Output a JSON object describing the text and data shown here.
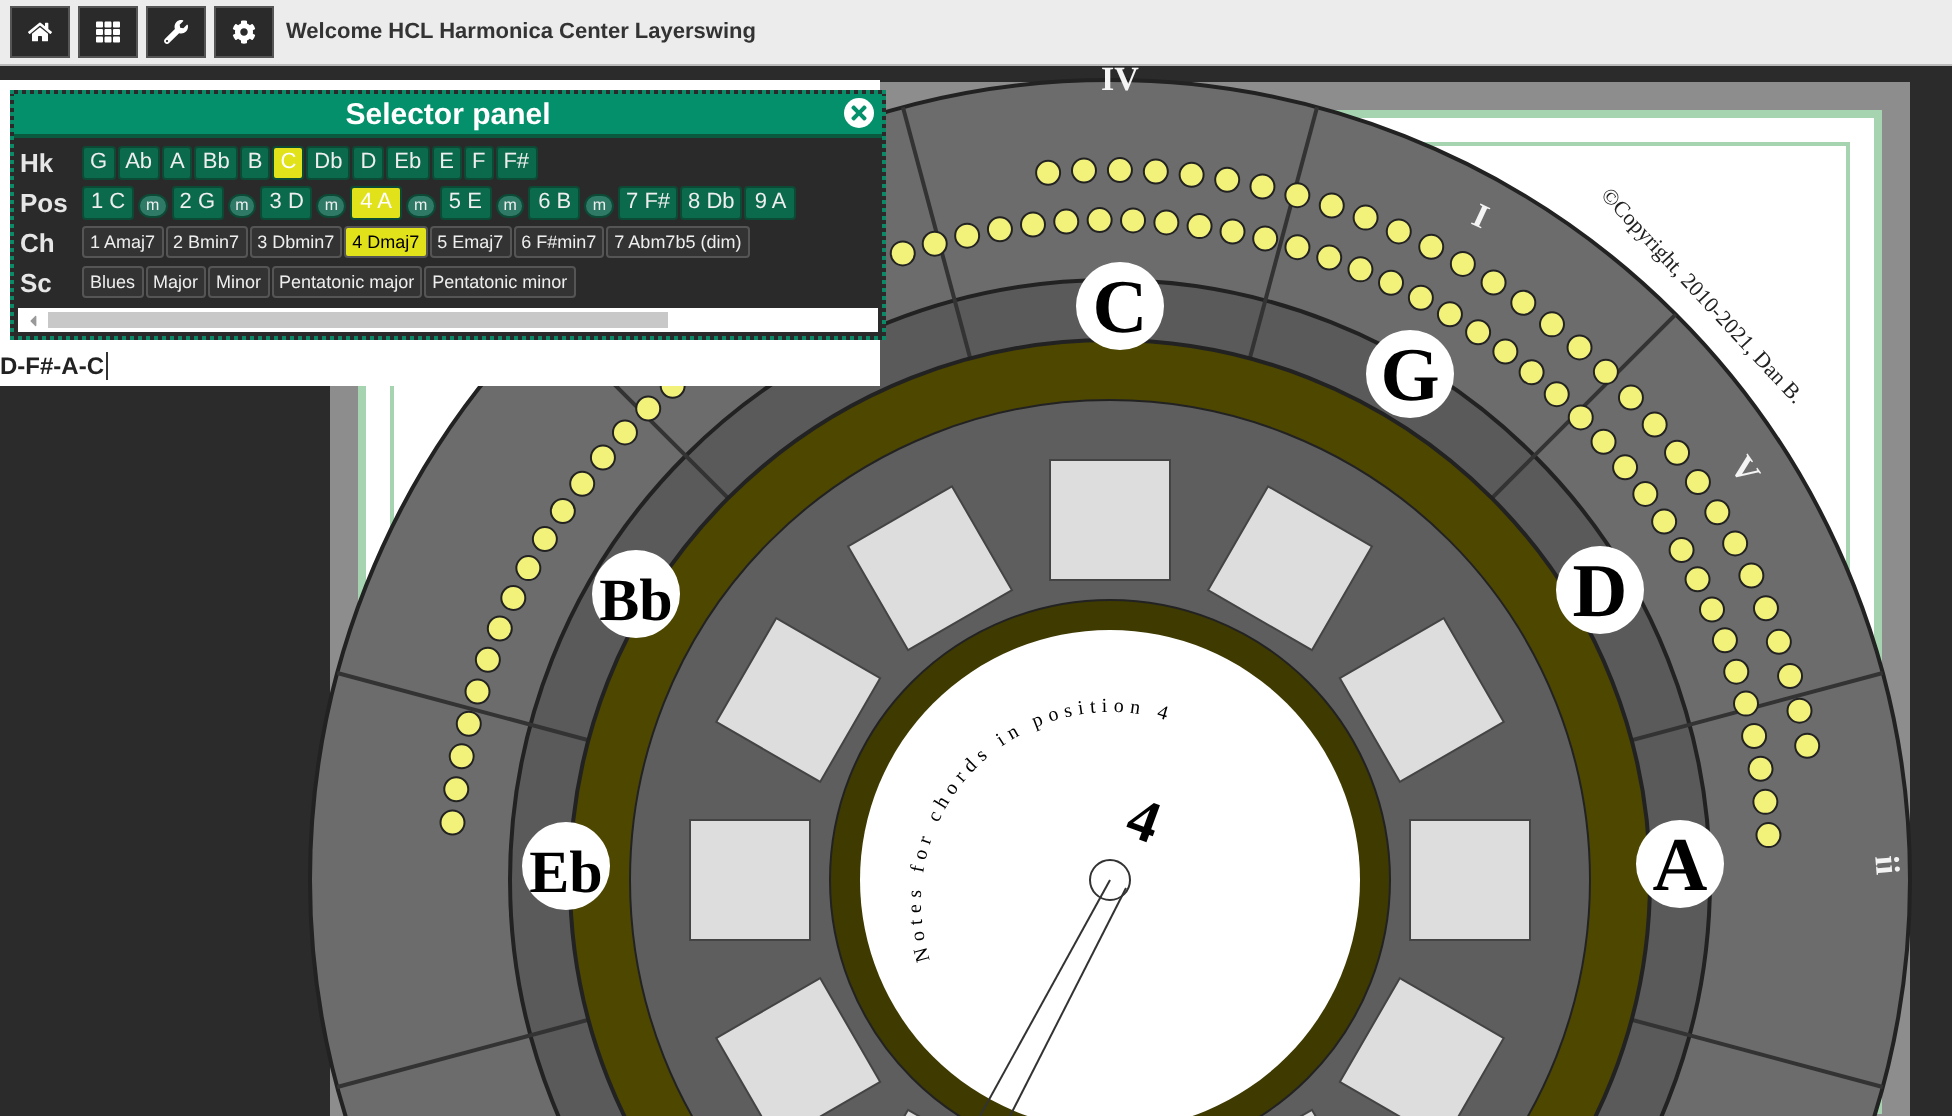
{
  "toolbar": {
    "title": "Welcome HCL Harmonica Center Layerswing"
  },
  "selector_panel": {
    "title": "Selector panel",
    "rows": [
      {
        "label": "Hk",
        "items": [
          {
            "label": "G",
            "kind": "key",
            "selected": false
          },
          {
            "label": "Ab",
            "kind": "key",
            "selected": false
          },
          {
            "label": "A",
            "kind": "key",
            "selected": false
          },
          {
            "label": "Bb",
            "kind": "key",
            "selected": false
          },
          {
            "label": "B",
            "kind": "key",
            "selected": false
          },
          {
            "label": "C",
            "kind": "key",
            "selected": true
          },
          {
            "label": "Db",
            "kind": "key",
            "selected": false
          },
          {
            "label": "D",
            "kind": "key",
            "selected": false
          },
          {
            "label": "Eb",
            "kind": "key",
            "selected": false
          },
          {
            "label": "E",
            "kind": "key",
            "selected": false
          },
          {
            "label": "F",
            "kind": "key",
            "selected": false
          },
          {
            "label": "F#",
            "kind": "key",
            "selected": false
          }
        ]
      },
      {
        "label": "Pos",
        "items": [
          {
            "label": "1 C",
            "kind": "position",
            "selected": false
          },
          {
            "label": "m",
            "kind": "minor",
            "selected": false
          },
          {
            "label": "2 G",
            "kind": "position",
            "selected": false
          },
          {
            "label": "m",
            "kind": "minor",
            "selected": false
          },
          {
            "label": "3 D",
            "kind": "position",
            "selected": false
          },
          {
            "label": "m",
            "kind": "minor",
            "selected": false
          },
          {
            "label": "4 A",
            "kind": "position",
            "selected": true
          },
          {
            "label": "m",
            "kind": "minor",
            "selected": false
          },
          {
            "label": "5 E",
            "kind": "position",
            "selected": false
          },
          {
            "label": "m",
            "kind": "minor",
            "selected": false
          },
          {
            "label": "6 B",
            "kind": "position",
            "selected": false
          },
          {
            "label": "m",
            "kind": "minor",
            "selected": false
          },
          {
            "label": "7 F#",
            "kind": "position",
            "selected": false
          },
          {
            "label": "8 Db",
            "kind": "position",
            "selected": false
          },
          {
            "label": "9 A",
            "kind": "position",
            "selected": false
          }
        ]
      },
      {
        "label": "Ch",
        "items": [
          {
            "label": "1 Amaj7",
            "kind": "small",
            "selected": false
          },
          {
            "label": "2 Bmin7",
            "kind": "small",
            "selected": false
          },
          {
            "label": "3 Dbmin7",
            "kind": "small",
            "selected": false
          },
          {
            "label": "4 Dmaj7",
            "kind": "small",
            "selected": true
          },
          {
            "label": "5 Emaj7",
            "kind": "small",
            "selected": false
          },
          {
            "label": "6 F#min7",
            "kind": "small",
            "selected": false
          },
          {
            "label": "7 Abm7b5 (dim)",
            "kind": "small",
            "selected": false
          }
        ]
      },
      {
        "label": "Sc",
        "items": [
          {
            "label": "Blues",
            "kind": "small",
            "selected": false
          },
          {
            "label": "Major",
            "kind": "small",
            "selected": false
          },
          {
            "label": "Minor",
            "kind": "small",
            "selected": false
          },
          {
            "label": "Pentatonic major",
            "kind": "small",
            "selected": false
          },
          {
            "label": "Pentatonic minor",
            "kind": "small",
            "selected": false
          }
        ]
      }
    ]
  },
  "chord_notes": "D-F#-A-C",
  "wheel": {
    "keys": [
      "C",
      "G",
      "D",
      "A",
      "Eb",
      "Bb"
    ],
    "numerals": [
      "IV",
      "I",
      "V",
      "ii"
    ],
    "center_number": "4",
    "caption": "Notes for chords in position 4",
    "copyright": "©Copyright, 2010-2021, Dan B."
  }
}
